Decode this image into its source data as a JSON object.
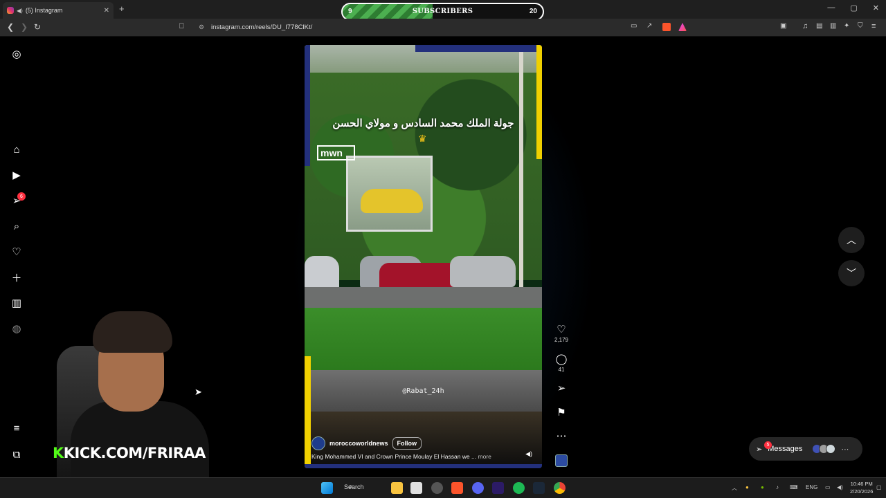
{
  "browser": {
    "tab_title": "(5) Instagram",
    "tab_close": "✕",
    "new_tab": "+",
    "url": "instagram.com/reels/DU_I778ClKt/",
    "window_controls": [
      "—",
      "▢",
      "✕"
    ]
  },
  "overlay": {
    "subscribers_label": "SUBSCRIBERS",
    "current": "9",
    "goal": "20",
    "progress": 0.45
  },
  "sidebar": {
    "notifications_badge": "6",
    "items": [
      "instagram-logo",
      "home",
      "reels",
      "messages",
      "search",
      "notifications",
      "create",
      "dashboard",
      "profile",
      "more",
      "also-from-meta"
    ]
  },
  "reel": {
    "overlay_headline": "جولة الملك محمد السادس و مولاي الحسن",
    "watermark": "mwn",
    "credit": "@Rabat_24h",
    "account": "moroccoworldnews",
    "follow_label": "Follow",
    "caption": "King Mohammed VI and Crown Prince Moulay El Hassan we ...",
    "more_label": "more",
    "likes": "2,179",
    "comments": "41"
  },
  "messages": {
    "label": "Messages",
    "badge": "5"
  },
  "stream": {
    "kick_url": "KICK.COM/FRIRAA",
    "kick_logo": "K"
  },
  "taskbar": {
    "search_label": "Search",
    "language": "ENG",
    "time": "10:46 PM",
    "date": "2/20/2026"
  },
  "colors": {
    "instagram_dark": "#000000",
    "notification_red": "#ff3040",
    "kick_green": "#53fc18",
    "progress_green": "#4caf50",
    "reel_yellow": "#f0d000",
    "reel_navy": "#23307c"
  }
}
